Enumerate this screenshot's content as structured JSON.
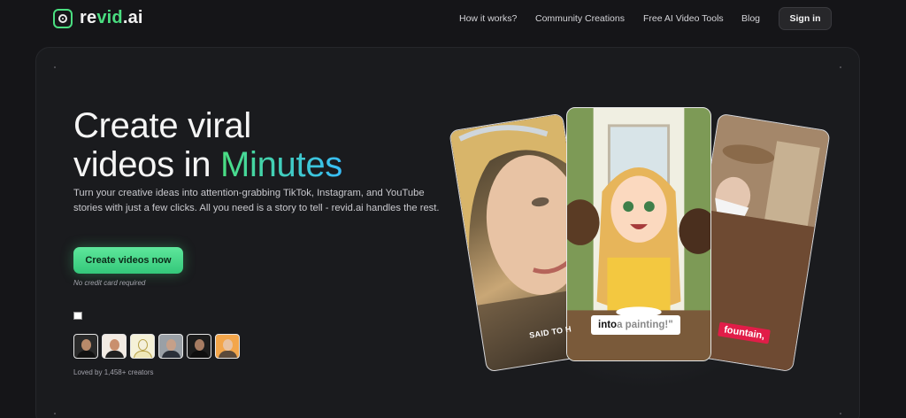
{
  "nav": {
    "logo": {
      "prefix": "re",
      "accent": "vid",
      "suffix": ".ai"
    },
    "links": [
      "How it works?",
      "Community Creations",
      "Free AI Video Tools",
      "Blog"
    ],
    "signin": "Sign in"
  },
  "hero": {
    "title_line1": "Create viral",
    "title_line2_plain": "videos in ",
    "title_line2_accent": "Minutes",
    "subtitle": "Turn your creative ideas into attention-grabbing TikTok, Instagram, and YouTube stories with just a few clicks. All you need is a story to tell - revid.ai handles the rest.",
    "cta": "Create videos now",
    "cta_note": "No credit card required",
    "loved": "Loved by 1,458+ creators"
  },
  "cards": {
    "left_caption": "SAID TO H",
    "center_caption_bold": "into",
    "center_caption_soft": " a painting!\"",
    "right_caption": "fountain,"
  },
  "colors": {
    "accent": "#4ade80",
    "accent2": "#38bdf8",
    "bg": "#151518",
    "panel": "#1a1b1e"
  }
}
